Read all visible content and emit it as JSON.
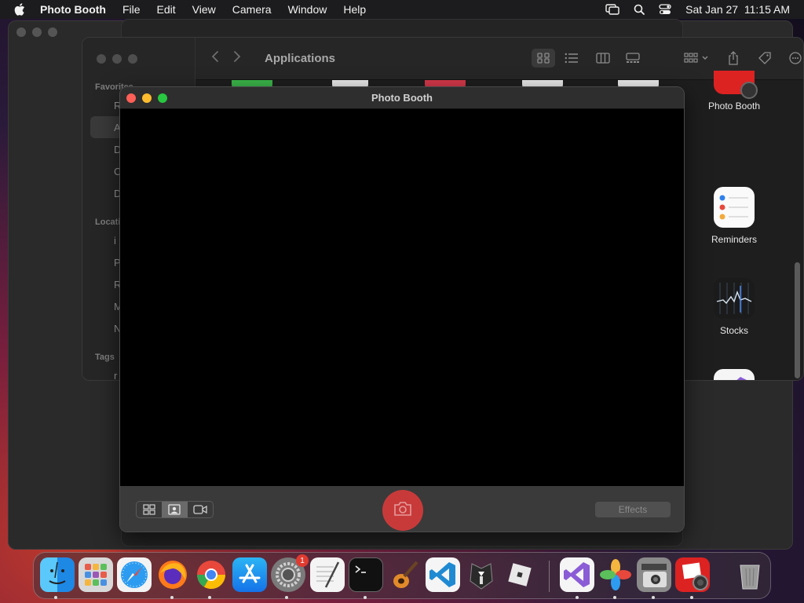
{
  "menubar": {
    "app_name": "Photo Booth",
    "menus": [
      "File",
      "Edit",
      "View",
      "Camera",
      "Window",
      "Help"
    ],
    "datetime": "Sat Jan 27  11:15 AM",
    "icons": [
      "apple-icon",
      "screen-mirroring-icon",
      "search-icon",
      "control-center-icon"
    ]
  },
  "finder": {
    "title": "Applications",
    "sidebar": {
      "favorites_label": "Favorites",
      "locations_label": "Locations",
      "tags_label": "Tags",
      "items": [
        "R",
        "A",
        "D",
        "C",
        "D"
      ],
      "location_items": [
        "i",
        "P",
        "R",
        "M",
        "N"
      ],
      "tag_items": [
        "r"
      ]
    },
    "apps": [
      {
        "label": "Photo Booth",
        "icon": "photo-booth-icon"
      },
      {
        "label": "Reminders",
        "icon": "reminders-icon"
      },
      {
        "label": "Stocks",
        "icon": "stocks-icon"
      },
      {
        "label": "",
        "icon": "visual-studio-icon"
      }
    ]
  },
  "photobooth": {
    "title": "Photo Booth",
    "effects_label": "Effects",
    "modes": [
      "grid-mode-icon",
      "single-photo-icon",
      "video-icon"
    ],
    "selected_mode": "single-photo-icon",
    "colors": {
      "shutter": "#c83a3a",
      "close": "#ff5f57",
      "minimize": "#febc2e",
      "zoom": "#28c840"
    }
  },
  "dock": {
    "items": [
      "finder-icon",
      "launchpad-icon",
      "safari-icon",
      "firefox-icon",
      "chrome-icon",
      "app-store-icon",
      "system-settings-icon",
      "textedit-icon",
      "terminal-icon",
      "garageband-icon",
      "vscode-icon",
      "tux-icon",
      "roblox-icon",
      "visual-studio-icon",
      "photos-icon",
      "image-capture-icon",
      "photo-booth-icon",
      "trash-icon"
    ],
    "settings_badge": "1"
  }
}
